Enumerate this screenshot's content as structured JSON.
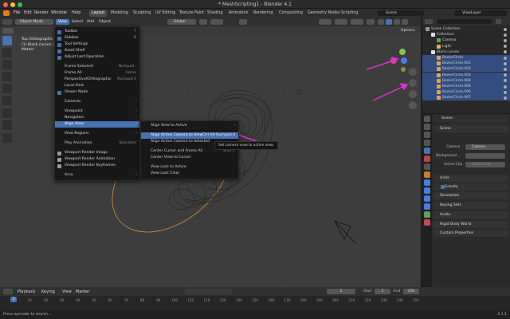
{
  "window": {
    "title": "* MeshScripting1 - Blender 4.1"
  },
  "menubar": {
    "items": [
      "File",
      "Edit",
      "Render",
      "Window",
      "Help"
    ],
    "workspaces": [
      "Layout",
      "Modeling",
      "Sculpting",
      "UV Editing",
      "Texture Paint",
      "Shading",
      "Animation",
      "Rendering",
      "Compositing",
      "Geometry Nodes",
      "Scripting"
    ],
    "active_workspace": "Layout",
    "scene_label": "Scene",
    "viewlayer_label": "ViewLayer"
  },
  "viewport": {
    "mode": "Object Mode",
    "menus": [
      "View",
      "Select",
      "Add",
      "Object"
    ],
    "transform": "Global",
    "options_label": "Options",
    "overlay_text": [
      "Top Orthographic",
      "(1) Black curves | ",
      "Meters"
    ]
  },
  "view_menu": {
    "items": [
      {
        "label": "Toolbar",
        "shortcut": "T",
        "check": true
      },
      {
        "label": "Sidebar",
        "shortcut": "N",
        "check": true
      },
      {
        "label": "Tool Settings",
        "shortcut": "",
        "check": true
      },
      {
        "label": "Asset Shelf",
        "shortcut": "",
        "check": true
      },
      {
        "label": "Adjust Last Operation",
        "shortcut": "",
        "check": true
      },
      {
        "sep": true
      },
      {
        "label": "Frame Selected",
        "shortcut": "Numpad ."
      },
      {
        "label": "Frame All",
        "shortcut": "Home"
      },
      {
        "label": "Perspective/Orthographic",
        "shortcut": "Numpad 5"
      },
      {
        "label": "Local View",
        "arrow": true
      },
      {
        "label": "Viewer Node",
        "shortcut": "",
        "check": true
      },
      {
        "sep": true
      },
      {
        "label": "Cameras",
        "arrow": true
      },
      {
        "sep": true
      },
      {
        "label": "Viewpoint",
        "arrow": true
      },
      {
        "label": "Navigation",
        "arrow": true
      },
      {
        "label": "Align View",
        "arrow": true,
        "highlight": true
      },
      {
        "sep": true
      },
      {
        "label": "View Regions",
        "arrow": true
      },
      {
        "sep": true
      },
      {
        "label": "Play Animation",
        "shortcut": "Spacebar"
      },
      {
        "sep": true
      },
      {
        "label": "Viewport Render Image",
        "icon": true
      },
      {
        "label": "Viewport Render Animation",
        "icon": true
      },
      {
        "label": "Viewport Render Keyframes",
        "icon": true
      },
      {
        "sep": true
      },
      {
        "label": "Area",
        "arrow": true
      }
    ]
  },
  "align_menu": {
    "items": [
      {
        "label": "Align View to Active",
        "arrow": true
      },
      {
        "sep": true
      },
      {
        "label": "Align Active Camera to View",
        "shortcut": "Ctrl Alt Numpad 0",
        "highlight": true
      },
      {
        "label": "Align Active Camera to Selected",
        "shortcut": ""
      },
      {
        "sep": true
      },
      {
        "label": "Center Cursor and Frame All",
        "shortcut": "Shift C"
      },
      {
        "label": "Center View to Cursor",
        "shortcut": ""
      },
      {
        "sep": true
      },
      {
        "label": "View Lock to Active",
        "shortcut": ""
      },
      {
        "label": "View Lock Clear",
        "shortcut": ""
      }
    ]
  },
  "tooltip": "Set camera view to active view.",
  "outliner": {
    "search_placeholder": "",
    "rows": [
      {
        "label": "Scene Collection",
        "indent": 0,
        "color": "#9a9a9a"
      },
      {
        "label": "Collection",
        "indent": 1,
        "color": "#e0e0e0"
      },
      {
        "label": "Camera",
        "indent": 2,
        "color": "#5aa35a"
      },
      {
        "label": "Light",
        "indent": 2,
        "color": "#d9b650"
      },
      {
        "label": "Black curves",
        "indent": 1,
        "color": "#e0e0e0"
      },
      {
        "label": "BezierCircle",
        "indent": 2,
        "color": "#e0a24a",
        "sel": true
      },
      {
        "label": "BezierCircle.001",
        "indent": 2,
        "color": "#e0a24a",
        "sel": true
      },
      {
        "label": "BezierCircle.002",
        "indent": 2,
        "color": "#e0a24a",
        "sel": true
      },
      {
        "label": "BezierCircle.003",
        "indent": 2,
        "color": "#e0a24a",
        "sel": true
      },
      {
        "label": "BezierCircle.004",
        "indent": 2,
        "color": "#e0a24a",
        "sel": true
      },
      {
        "label": "BezierCircle.005",
        "indent": 2,
        "color": "#e0a24a",
        "sel": true
      },
      {
        "label": "BezierCircle.006",
        "indent": 2,
        "color": "#e0a24a",
        "sel": true
      },
      {
        "label": "BezierCircle.007",
        "indent": 2,
        "color": "#e0a24a",
        "sel": true
      }
    ]
  },
  "properties": {
    "header": "Scene",
    "sections": [
      "Scene",
      "Units",
      "Gravity",
      "Simulation",
      "Keying Sets",
      "Audio",
      "Rigid Body World",
      "Custom Properties"
    ],
    "camera_label": "Camera",
    "camera_value": "Camera",
    "background_label": "Background ...",
    "active_clip_label": "Active Clip",
    "active_clip_value": "Active Clip"
  },
  "timeline": {
    "menus": [
      "Playback",
      "Keying",
      "View",
      "Marker"
    ],
    "current_frame": "1",
    "start_label": "Start",
    "start": "1",
    "end_label": "End",
    "end": "250",
    "ticks": [
      "0",
      "10",
      "20",
      "30",
      "40",
      "50",
      "60",
      "70",
      "80",
      "90",
      "100",
      "110",
      "120",
      "130",
      "140",
      "150",
      "160",
      "170",
      "180",
      "190",
      "200",
      "210",
      "220",
      "230",
      "240",
      "250"
    ]
  },
  "statusbar": {
    "left": "Press operator to search...",
    "right": "4.1.1"
  },
  "colors": {
    "accent": "#4772b3",
    "annotation_arrow": "#e02fd0",
    "selected_curve": "#d9913a"
  }
}
